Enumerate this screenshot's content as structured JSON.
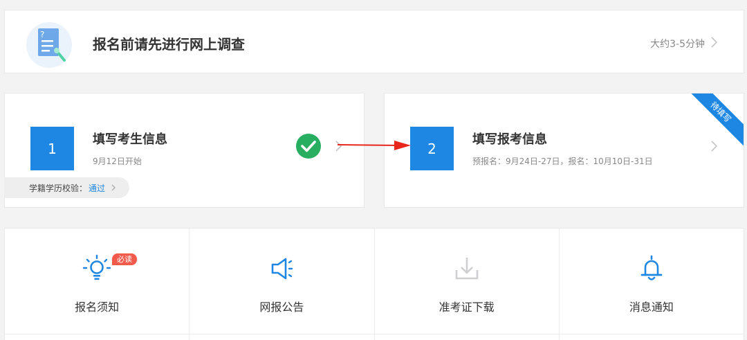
{
  "survey": {
    "title": "报名前请先进行网上调查",
    "duration": "大约3-5分钟"
  },
  "steps": [
    {
      "number": "1",
      "title": "填写考生信息",
      "subtitle": "9月12日开始",
      "status": "complete",
      "verification_label": "学籍学历校验：",
      "verification_value": "通过"
    },
    {
      "number": "2",
      "title": "填写报考信息",
      "subtitle": "预报名：9月24日-27日，报名：10月10日-31日",
      "ribbon": "待填写"
    }
  ],
  "shortcuts": [
    {
      "label": "报名须知",
      "icon": "lightbulb-icon",
      "badge": "必读"
    },
    {
      "label": "网报公告",
      "icon": "megaphone-icon"
    },
    {
      "label": "准考证下载",
      "icon": "download-icon"
    },
    {
      "label": "消息通知",
      "icon": "bell-icon"
    }
  ],
  "colors": {
    "accent": "#1e87e4",
    "success": "#27ae60",
    "badge": "#f25a4b",
    "annotation_arrow": "#e8261c"
  }
}
